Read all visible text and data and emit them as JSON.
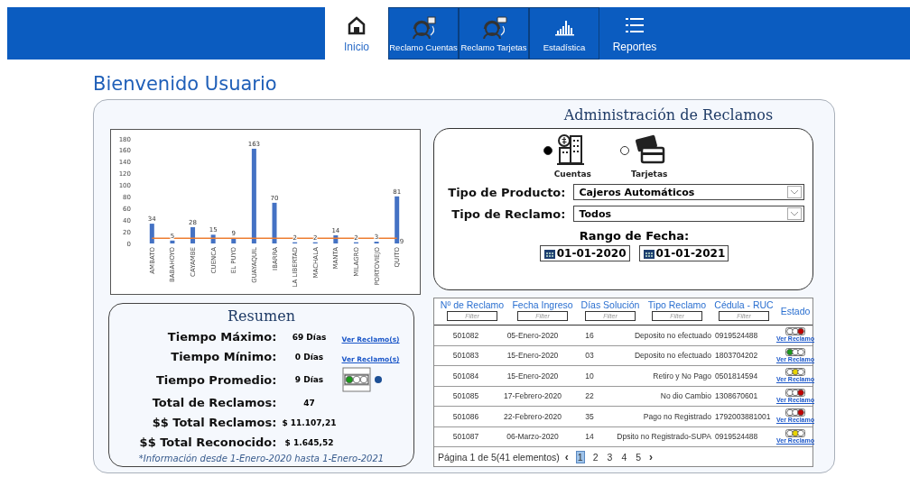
{
  "nav": {
    "tabs": [
      {
        "label": "Inicio",
        "selected": true
      },
      {
        "label": "Reclamo Cuentas",
        "selected": false
      },
      {
        "label": "Reclamo Tarjetas",
        "selected": false
      },
      {
        "label": "Estadística",
        "selected": false
      },
      {
        "label": "Reportes",
        "selected": false
      }
    ]
  },
  "page_title": "Bienvenido Usuario",
  "chart": {
    "chart_data": {
      "type": "bar",
      "categories": [
        "AMBATO",
        "BABAHOYO",
        "CAYAMBE",
        "CUENCA",
        "EL PUYO",
        "GUAYAQUIL",
        "IBARRA",
        "LA LIBERTAD",
        "MACHALA",
        "MANTA",
        "MILAGRO",
        "PORTOVIEJO",
        "QUITO"
      ],
      "series": [
        {
          "color": "#4472c4",
          "values": [
            34,
            5,
            28,
            15,
            9,
            163,
            70,
            2,
            2,
            14,
            2,
            3,
            81
          ]
        },
        {
          "color": "#ed7d31",
          "type": "line",
          "values": [
            9,
            9,
            9,
            9,
            9,
            9,
            9,
            9,
            9,
            9,
            9,
            9,
            9
          ]
        }
      ],
      "ylim": [
        0,
        180
      ],
      "yticks": [
        0,
        20,
        40,
        60,
        80,
        100,
        120,
        140,
        160,
        180
      ],
      "value_labels": [
        [
          "34",
          "5",
          "28",
          "15",
          "9",
          "163",
          "70",
          "2",
          "2",
          "14",
          "2",
          "3",
          "81"
        ],
        [
          null,
          null,
          null,
          null,
          null,
          null,
          null,
          null,
          null,
          null,
          null,
          null,
          "9"
        ]
      ]
    }
  },
  "admin": {
    "title": "Administración de Reclamos",
    "options": [
      {
        "label": "Cuentas",
        "selected": true
      },
      {
        "label": "Tarjetas",
        "selected": false
      }
    ],
    "product": {
      "label": "Tipo de Producto:",
      "value": "Cajeros Automáticos"
    },
    "claim_type": {
      "label": "Tipo de Reclamo:",
      "value": "Todos"
    },
    "date_range": {
      "label": "Rango de Fecha:",
      "from": "01-01-2020",
      "to": "01-01-2021"
    }
  },
  "summary": {
    "title": "Resumen",
    "rows": [
      {
        "label": "Tiempo Máximo:",
        "value": "69 Días",
        "link": "Ver Reclamo(s)"
      },
      {
        "label": "Tiempo Mínimo:",
        "value": "0 Días",
        "link": "Ver Reclamo(s)"
      },
      {
        "label": "Tiempo Promedio:",
        "value": "9 Días",
        "color": "#1a9a1a"
      },
      {
        "label": "Total de Reclamos:",
        "value": "47"
      },
      {
        "label": "$$ Total Reclamos:",
        "value": "$ 11.107,21"
      },
      {
        "label": "$$ Total Reconocido:",
        "value": "$ 1.645,52"
      }
    ],
    "note": "*Información desde 1-Enero-2020 hasta 1-Enero-2021"
  },
  "table": {
    "columns": [
      {
        "label": "Nº de Reclamo",
        "filter": "Filter"
      },
      {
        "label": "Fecha Ingreso",
        "filter": "Filter"
      },
      {
        "label": "Días Solución",
        "filter": "Filter"
      },
      {
        "label": "Tipo Reclamo",
        "filter": "Filter"
      },
      {
        "label": "Cédula - RUC",
        "filter": "Filter"
      },
      {
        "label": "Estado"
      }
    ],
    "rows": [
      {
        "cells": [
          "501082",
          "05-Enero-2020",
          "16",
          "Deposito no efectuado",
          "0919524488"
        ],
        "color": "#c00000",
        "link": "Ver Reclamo"
      },
      {
        "cells": [
          "501083",
          "15-Enero-2020",
          "03",
          "Deposito no efectuado",
          "1803704202"
        ],
        "color": "#1a9a1a",
        "link": "Ver Reclamo"
      },
      {
        "cells": [
          "501084",
          "15-Enero-2020",
          "10",
          "Retiro y No Pago",
          "0501814594"
        ],
        "color": "#e8d400",
        "link": "Ver Reclamo"
      },
      {
        "cells": [
          "501085",
          "17-Febrero-2020",
          "22",
          "No dio Cambio",
          "1308670601"
        ],
        "color": "#c00000",
        "link": "Ver Reclamo"
      },
      {
        "cells": [
          "501086",
          "22-Febrero-2020",
          "35",
          "Pago no Registrado",
          "1792003881001"
        ],
        "color": "#c00000",
        "link": "Ver Reclamo"
      },
      {
        "cells": [
          "501087",
          "06-Marzo-2020",
          "14",
          "Dpsito no Registrado-SUPA",
          "0919524488"
        ],
        "color": "#e8d400",
        "link": "Ver Reclamo"
      }
    ],
    "pager": {
      "info": "Página 1 de 5(41 elementos)",
      "prev": "‹",
      "next": "›",
      "pages": [
        {
          "label": "1",
          "selected": true
        },
        {
          "label": "2",
          "selected": false
        },
        {
          "label": "3",
          "selected": false
        },
        {
          "label": "4",
          "selected": false
        },
        {
          "label": "5",
          "selected": false
        }
      ]
    }
  }
}
